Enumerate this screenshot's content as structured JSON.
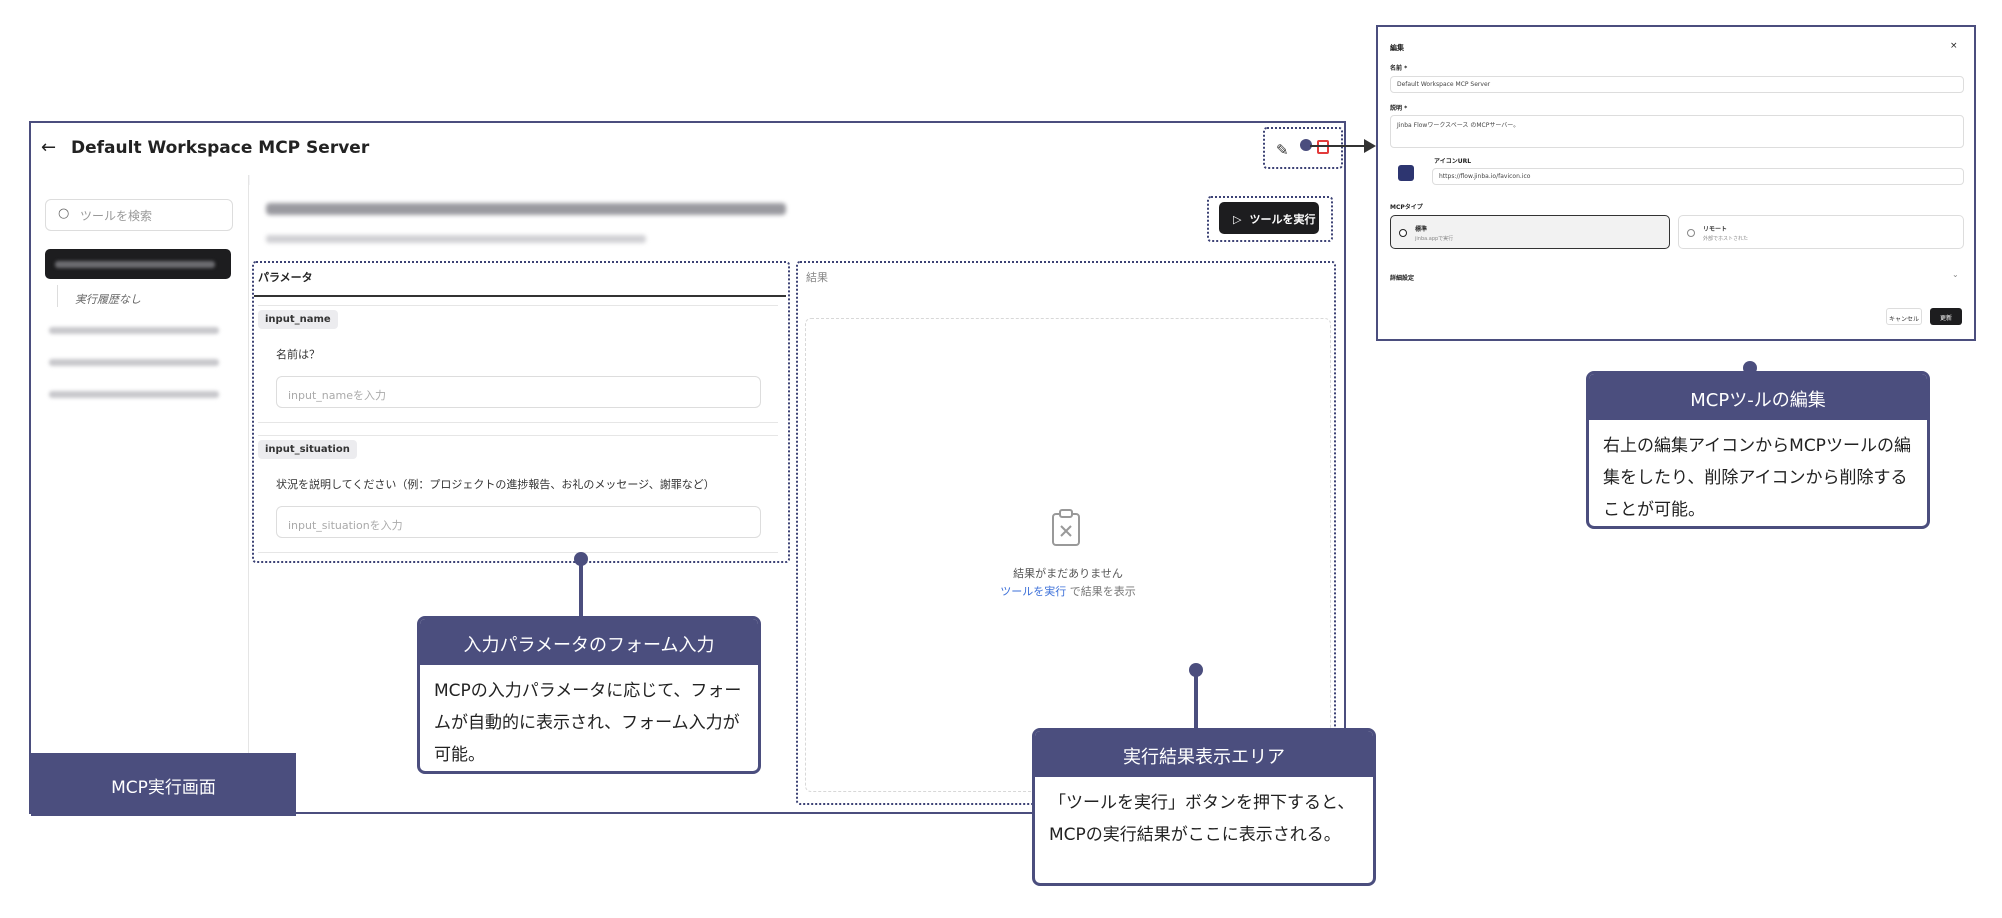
{
  "screen": {
    "title": "Default Workspace MCP Server",
    "search_placeholder": "ツールを検索",
    "history_empty": "実行履歴なし",
    "params_header": "パラメータ",
    "results_header": "結果",
    "run_button": "ツールを実行",
    "params": [
      {
        "name": "input_name",
        "question": "名前は？",
        "placeholder": "input_nameを入力"
      },
      {
        "name": "input_situation",
        "question": "状況を説明してください（例：プロジェクトの進捗報告、お礼のメッセージ、謝罪など）",
        "placeholder": "input_situationを入力"
      }
    ],
    "empty_title": "結果がまだありません",
    "empty_link": "ツールを実行",
    "empty_suffix": " で結果を表示",
    "screen_label": "MCP実行画面"
  },
  "callouts": {
    "params": {
      "title": "入力パラメータのフォーム入力",
      "body": "MCPの入力パラメータに応じて、フォームが自動的に表示され、フォーム入力が可能。"
    },
    "results": {
      "title": "実行結果表示エリア",
      "body": "「ツールを実行」ボタンを押下すると、MCPの実行結果がここに表示される。"
    },
    "edit": {
      "title": "MCPツ-ルの編集",
      "body": "右上の編集アイコンからMCPツールの編集をしたり、削除アイコンから削除することが可能。"
    }
  },
  "dialog": {
    "title": "編集",
    "close": "×",
    "name_label": "名前 *",
    "name_value": "Default Workspace MCP Server",
    "desc_label": "説明 *",
    "desc_value": "Jinba Flowワークスペース のMCPサーバー。",
    "icon_label": "アイコンURL",
    "icon_value": "https://flow.jinba.io/favicon.ico",
    "type_label": "MCPタイプ",
    "type_standard": "標準",
    "type_standard_sub": "jinba.appで実行",
    "type_remote": "リモート",
    "type_remote_sub": "外部でホストされた",
    "advanced": "詳細設定",
    "cancel": "キャンセル",
    "update": "更新"
  },
  "colors": {
    "accent": "#4b4e7e",
    "dark": "#1d1d1f",
    "link": "#3b6fd8",
    "delete": "#e23b3b"
  }
}
